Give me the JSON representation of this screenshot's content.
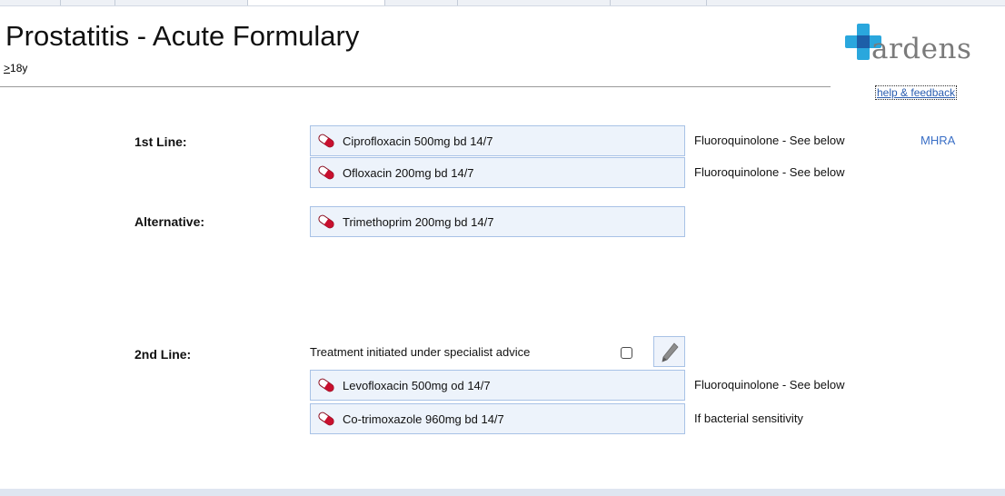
{
  "header": {
    "title": "Prostatitis - Acute Formulary",
    "age_symbol": ">",
    "age_text": "18y"
  },
  "brand": {
    "logo_text": "ardens",
    "help_link": "help & feedback",
    "colors": {
      "cross_light": "#2aa7dd",
      "cross_dark": "#1d5fa8",
      "pill": "#c8102e"
    }
  },
  "sections": {
    "first_line": {
      "label": "1st Line:",
      "items": [
        {
          "drug": "Ciprofloxacin 500mg bd 14/7",
          "note": "Fluoroquinolone  - See below",
          "link": "MHRA"
        },
        {
          "drug": "Ofloxacin 200mg bd 14/7",
          "note": "Fluoroquinolone  - See below"
        }
      ]
    },
    "alternative": {
      "label": "Alternative:",
      "items": [
        {
          "drug": "Trimethoprim 200mg bd 14/7"
        }
      ]
    },
    "second_line": {
      "label": "2nd Line:",
      "specialist_text": "Treatment initiated under specialist advice",
      "specialist_checked": false,
      "items": [
        {
          "drug": "Levofloxacin 500mg od 14/7",
          "note": "Fluoroquinolone  - See below"
        },
        {
          "drug": "Co-trimoxazole 960mg bd 14/7",
          "note": "If bacterial sensitivity"
        }
      ]
    }
  },
  "icons": {
    "drug": "pill-icon",
    "edit": "pencil-icon"
  }
}
